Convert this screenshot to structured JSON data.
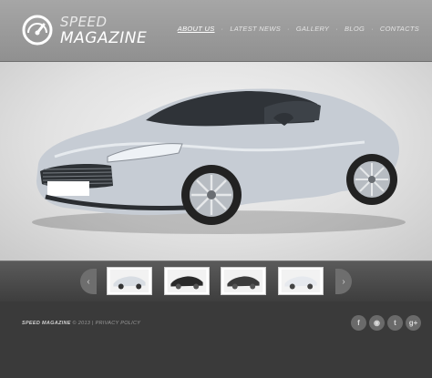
{
  "brand": {
    "line1": "SPEED",
    "line2": "MAGAZINE"
  },
  "nav": {
    "items": [
      {
        "label": "ABOUT US",
        "active": true
      },
      {
        "label": "LATEST NEWS",
        "active": false
      },
      {
        "label": "GALLERY",
        "active": false
      },
      {
        "label": "BLOG",
        "active": false
      },
      {
        "label": "CONTACTS",
        "active": false
      }
    ],
    "separator": "·"
  },
  "hero": {
    "car_color": "#c6ccd4"
  },
  "gallery": {
    "prev": "‹",
    "next": "›",
    "thumbnails": [
      {
        "car_color": "#d8dde3"
      },
      {
        "car_color": "#2a2a2a"
      },
      {
        "car_color": "#3b3b3b"
      },
      {
        "car_color": "#e6e9ee"
      }
    ]
  },
  "footer": {
    "brand": "SPEED MAGAZINE",
    "copyright": "© 2013",
    "separator": "|",
    "privacy": "PRIVACY POLICY",
    "social": [
      {
        "icon": "facebook-icon",
        "glyph": "f"
      },
      {
        "icon": "rss-icon",
        "glyph": "◉"
      },
      {
        "icon": "twitter-icon",
        "glyph": "t"
      },
      {
        "icon": "google-plus-icon",
        "glyph": "g+"
      }
    ]
  }
}
